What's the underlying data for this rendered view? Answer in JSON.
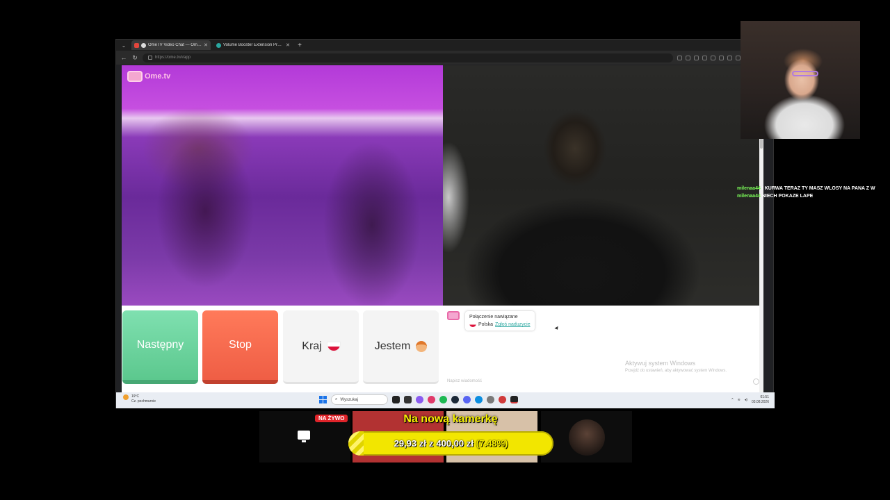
{
  "browser": {
    "tabs": [
      {
        "title": "OmeTV Video Chat — Omegl",
        "active": true,
        "color": "#e2463c"
      },
      {
        "title": "Volume Booster Extension Project",
        "active": false,
        "color": "#2aa7a0"
      }
    ],
    "url": "https://ome.tv/#app"
  },
  "app": {
    "logo_text": "Ome.tv",
    "buttons": {
      "next": "Następny",
      "stop": "Stop",
      "country": "Kraj",
      "gender": "Jestem"
    },
    "chat": {
      "status": "Połączenie nawiązane",
      "country": "Polska",
      "report": "Zgłoś naduzycie",
      "input_placeholder": "Napisz wiadomość"
    },
    "windows_activation": {
      "title": "Aktywuj system Windows",
      "subtitle": "Przejdź do ustawień, aby aktywować system Windows."
    }
  },
  "taskbar": {
    "weather": {
      "temp": "19°C",
      "desc": "Cz. pochmurnie",
      "badge": "2"
    },
    "search_placeholder": "Wyszukaj",
    "time": "01:51",
    "date": "03.08.2026"
  },
  "stream_chat": [
    {
      "user": "milenaa44",
      "message": "I KURWA TERAZ TY MASZ WLOSY NA PANA Z W"
    },
    {
      "user": "milenaa44",
      "message": "NIECH POKAZE LAPE"
    }
  ],
  "overlay": {
    "live_badge": "NA ŻYWO",
    "goal_title": "Na nową kamerkę",
    "goal_current": "29,93 zł",
    "goal_connector": "z",
    "goal_target": "400,00 zł",
    "goal_percent": "(7.48%)",
    "goal_progress": 0.0748
  },
  "colors": {
    "next": "#5cc88e",
    "stop": "#ef5e45",
    "accent_green": "#7dff5a",
    "goal_yellow": "#f2e600"
  }
}
